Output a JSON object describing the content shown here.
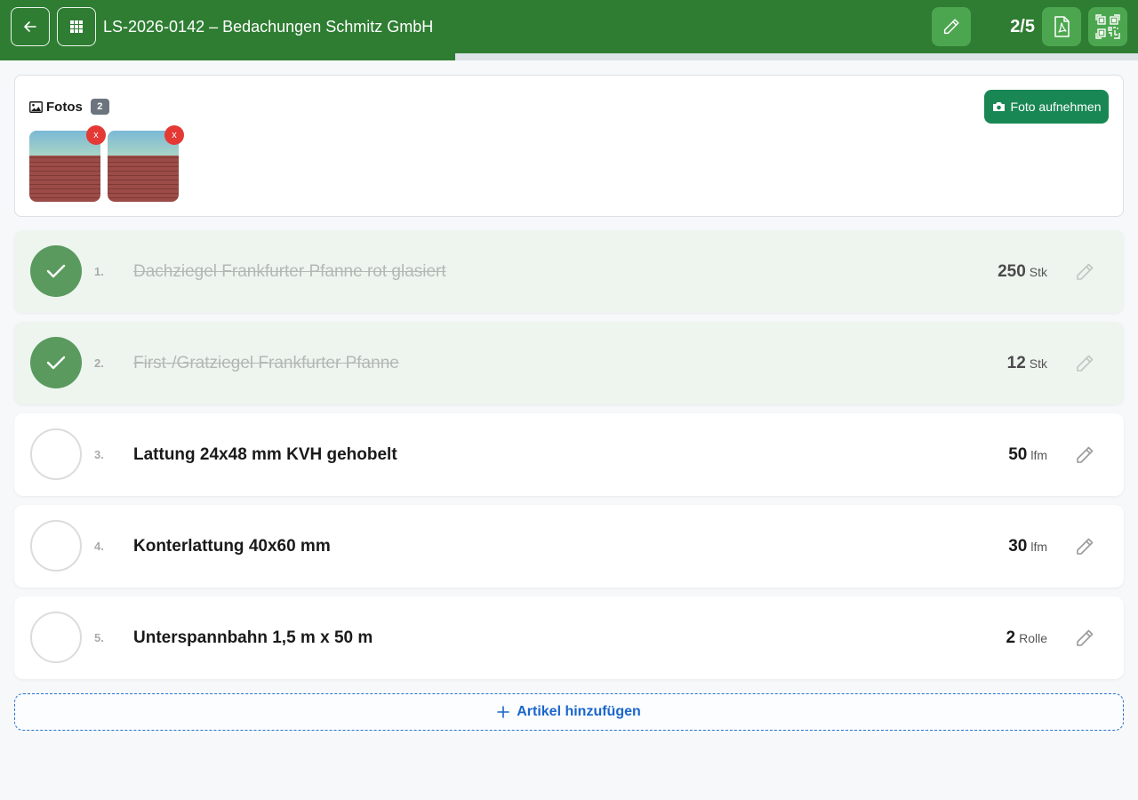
{
  "header": {
    "title": "LS-2026-0142 – Bedachungen Schmitz GmbH",
    "counter": "2/5",
    "progress": 0.4,
    "icons": {
      "back": "arrow-left-icon",
      "menu": "grid-icon",
      "edit": "pencil-icon",
      "pdf": "pdf-file-icon",
      "qr": "qr-code-icon"
    }
  },
  "photos": {
    "title": "Fotos",
    "count": "2",
    "capture_label": "Foto aufnehmen",
    "delete_label": "x"
  },
  "items": [
    {
      "num": "1.",
      "name": "Dachziegel Frankfurter Pfanne rot glasiert",
      "qty": "250",
      "unit": "Stk",
      "done": true
    },
    {
      "num": "2.",
      "name": "First-/Gratziegel Frankfurter Pfanne",
      "qty": "12",
      "unit": "Stk",
      "done": true
    },
    {
      "num": "3.",
      "name": "Lattung 24x48 mm KVH gehobelt",
      "qty": "50",
      "unit": "lfm",
      "done": false
    },
    {
      "num": "4.",
      "name": "Konterlattung 40x60 mm",
      "qty": "30",
      "unit": "lfm",
      "done": false
    },
    {
      "num": "5.",
      "name": "Unterspannbahn 1,5 m x 50 m",
      "qty": "2",
      "unit": "Rolle",
      "done": false
    }
  ],
  "add_label": "Artikel hinzufügen",
  "colors": {
    "header": "#2e7d32",
    "done_check": "#5a9a5e",
    "capture_button": "#198754",
    "delete_badge": "#e53935",
    "add_link": "#1a66cc"
  }
}
